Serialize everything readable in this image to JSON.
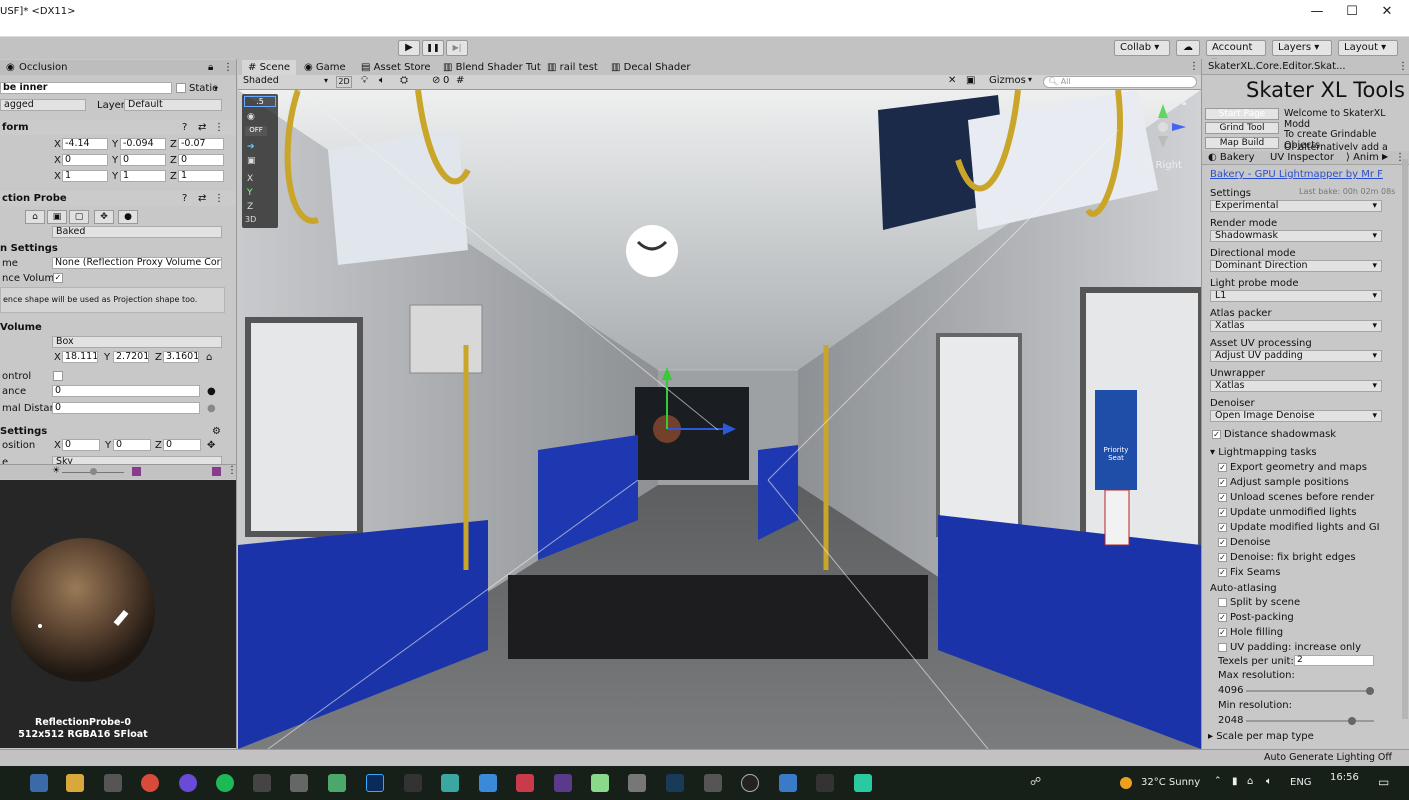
{
  "window": {
    "title": "USF]* <DX11>",
    "controls": [
      "—",
      "☐",
      "✕"
    ]
  },
  "toolbar": {
    "play": "▶",
    "pause": "❚❚",
    "step": "▶|",
    "collab": "Collab ▾",
    "account": "Account",
    "layers": "Layers",
    "layout": "Layout"
  },
  "inspector": {
    "occlusion_tab": "Occlusion",
    "name": "be inner",
    "static": "Static",
    "tag": "agged",
    "layer_label": "Layer",
    "layer": "Default",
    "transform": {
      "header": "form",
      "pos": {
        "x": "-4.14",
        "y": "-0.094",
        "z": "-0.07"
      },
      "rot": {
        "x": "0",
        "y": "0",
        "z": "0"
      },
      "scale": {
        "x": "1",
        "y": "1",
        "z": "1"
      }
    },
    "probe_header": "ction Probe",
    "type": "Baked",
    "settings_header": "n Settings",
    "proxy_label": "me",
    "proxy_value": "None (Reflection Proxy Volume Cor ⊙",
    "volume_label": "nce Volume",
    "help": "ence shape will be used as Projection shape too.",
    "volume_header": "Volume",
    "shape": "Box",
    "size": {
      "x": "18.1117",
      "y": "2.72015",
      "z": "3.16015"
    },
    "control_label": "ontrol",
    "distance_label": "ance",
    "distance_value": "0",
    "normal_label": "mal Distance",
    "normal_value": "0",
    "settings2_header": "Settings",
    "offset_label": "osition",
    "offset": {
      "x": "0",
      "y": "0",
      "z": "0"
    },
    "sky_label": "e",
    "sky_value": "Sky",
    "preview_name": "ReflectionProbe-0",
    "preview_format": "512x512 RGBA16 SFloat"
  },
  "view": {
    "tabs": [
      "Scene",
      "Game",
      "Asset Store",
      "Blend Shader Tut",
      "rail test",
      "Decal Shader"
    ],
    "shading": "Shaded",
    "mode2d": "2D",
    "gizmos": "Gizmos",
    "search_placeholder": "All",
    "hidden_count": "0",
    "overlay_label": ".5",
    "off_label": "OFF",
    "right_label": "< Right",
    "sign_label": "Priority Seat"
  },
  "tools": {
    "tab_title": "SkaterXL.Core.Editor.Skat...",
    "heading": "Skater XL Tools",
    "start_page": "Start Page",
    "welcome": "Welcome to SkaterXL Modd",
    "grind_tool": "Grind Tool",
    "grind_text": "To create Grindable Objects",
    "map_build": "Map Build",
    "map_text": "Or alternatively add a 'Grind",
    "sub_tabs": [
      "Bakery",
      "UV Inspector",
      "Anim"
    ],
    "link": "Bakery - GPU Lightmapper by Mr F",
    "settings_label": "Settings",
    "last_bake": "Last bake: 00h 02m 08s",
    "settings_value": "Experimental",
    "render_mode_label": "Render mode",
    "render_mode": "Shadowmask",
    "directional_label": "Directional mode",
    "directional": "Dominant Direction",
    "probe_mode_label": "Light probe mode",
    "probe_mode": "L1",
    "atlas_label": "Atlas packer",
    "atlas": "Xatlas",
    "uv_label": "Asset UV processing",
    "uv": "Adjust UV padding",
    "unwrapper_label": "Unwrapper",
    "unwrapper": "Xatlas",
    "denoiser_label": "Denoiser",
    "denoiser": "Open Image Denoise",
    "distance_shadow": "Distance shadowmask",
    "tasks_header": "Lightmapping tasks",
    "tasks": [
      "Export geometry and maps",
      "Adjust sample positions",
      "Unload scenes before render",
      "Update unmodified lights",
      "Update modified lights and GI",
      "Denoise",
      "Denoise: fix bright edges",
      "Fix Seams"
    ],
    "auto_header": "Auto-atlasing",
    "auto": [
      {
        "label": "Split by scene",
        "checked": false
      },
      {
        "label": "Post-packing",
        "checked": true
      },
      {
        "label": "Hole filling",
        "checked": true
      },
      {
        "label": "UV padding: increase only",
        "checked": false
      }
    ],
    "texels_label": "Texels per unit:",
    "texels": "2",
    "max_res_label": "Max resolution:",
    "max_res": "4096",
    "max_res_fraction": 1.0,
    "min_res_label": "Min resolution:",
    "min_res": "2048",
    "min_res_fraction": 0.85,
    "scale_label": "Scale per map type"
  },
  "status": {
    "auto_generate": "Auto Generate Lighting Off"
  },
  "taskbar": {
    "weather": "32°C Sunny",
    "lang": "ENG",
    "time": "16:56"
  }
}
